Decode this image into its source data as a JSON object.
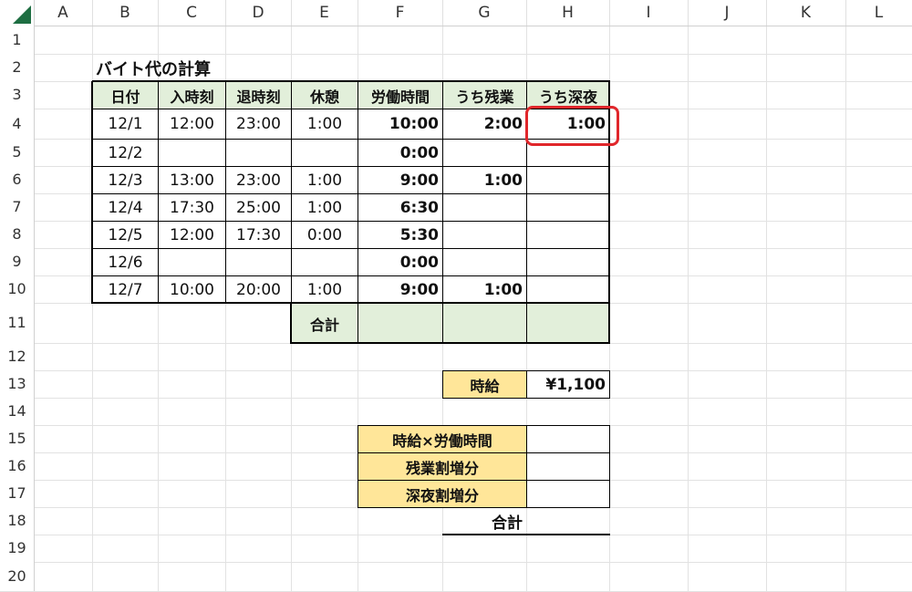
{
  "columns": [
    "A",
    "B",
    "C",
    "D",
    "E",
    "F",
    "G",
    "H",
    "I",
    "J",
    "K",
    "L"
  ],
  "rows": [
    "1",
    "2",
    "3",
    "4",
    "5",
    "6",
    "7",
    "8",
    "9",
    "10",
    "11",
    "12",
    "13",
    "14",
    "15",
    "16",
    "17",
    "18",
    "19",
    "20"
  ],
  "title": "バイト代の計算",
  "table": {
    "headers": [
      "日付",
      "入時刻",
      "退時刻",
      "休憩",
      "労働時間",
      "うち残業",
      "うち深夜"
    ],
    "rows": [
      [
        "12/1",
        "12:00",
        "23:00",
        "1:00",
        "10:00",
        "2:00",
        "1:00"
      ],
      [
        "12/2",
        "",
        "",
        "",
        "0:00",
        "",
        ""
      ],
      [
        "12/3",
        "13:00",
        "23:00",
        "1:00",
        "9:00",
        "1:00",
        ""
      ],
      [
        "12/4",
        "17:30",
        "25:00",
        "1:00",
        "6:30",
        "",
        ""
      ],
      [
        "12/5",
        "12:00",
        "17:30",
        "0:00",
        "5:30",
        "",
        ""
      ],
      [
        "12/6",
        "",
        "",
        "",
        "0:00",
        "",
        ""
      ],
      [
        "12/7",
        "10:00",
        "20:00",
        "1:00",
        "9:00",
        "1:00",
        ""
      ]
    ],
    "total_label": "合計"
  },
  "wage": {
    "label": "時給",
    "value": "¥1,100"
  },
  "calc": {
    "rows": [
      "時給×労働時間",
      "残業割増分",
      "深夜割増分"
    ],
    "total_label": "合計"
  },
  "colors": {
    "header_green": "#e2efda",
    "header_yellow": "#ffe699",
    "highlight": "#e0262b",
    "excel_green": "#1e6e42"
  }
}
